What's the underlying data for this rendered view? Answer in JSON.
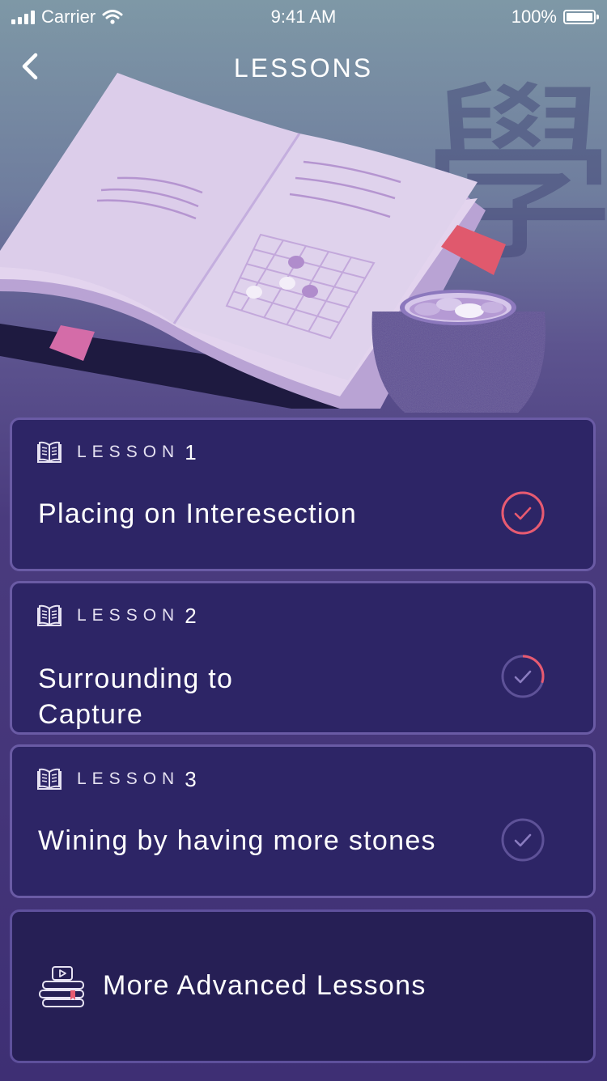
{
  "status_bar": {
    "carrier": "Carrier",
    "time": "9:41 AM",
    "battery": "100%"
  },
  "nav": {
    "title": "LESSONS"
  },
  "hero": {
    "watermark_glyph": "學"
  },
  "lessons": [
    {
      "word": "LESSON",
      "number": "1",
      "title_lines": [
        "Placing on Interesection"
      ],
      "progress": 1.0,
      "status": "completed"
    },
    {
      "word": "LESSON",
      "number": "2",
      "title_lines": [
        "Surrounding to",
        "Capture"
      ],
      "progress": 0.3,
      "status": "in-progress"
    },
    {
      "word": "LESSON",
      "number": "3",
      "title_lines": [
        "Wining by having more stones"
      ],
      "progress": 0.0,
      "status": "not-started"
    }
  ],
  "more": {
    "label": "More Advanced Lessons"
  },
  "colors": {
    "accent": "#e85a70",
    "ring_inactive": "#5e5298",
    "card_bg": "#2d2566",
    "card_border": "#6a5ba5"
  }
}
